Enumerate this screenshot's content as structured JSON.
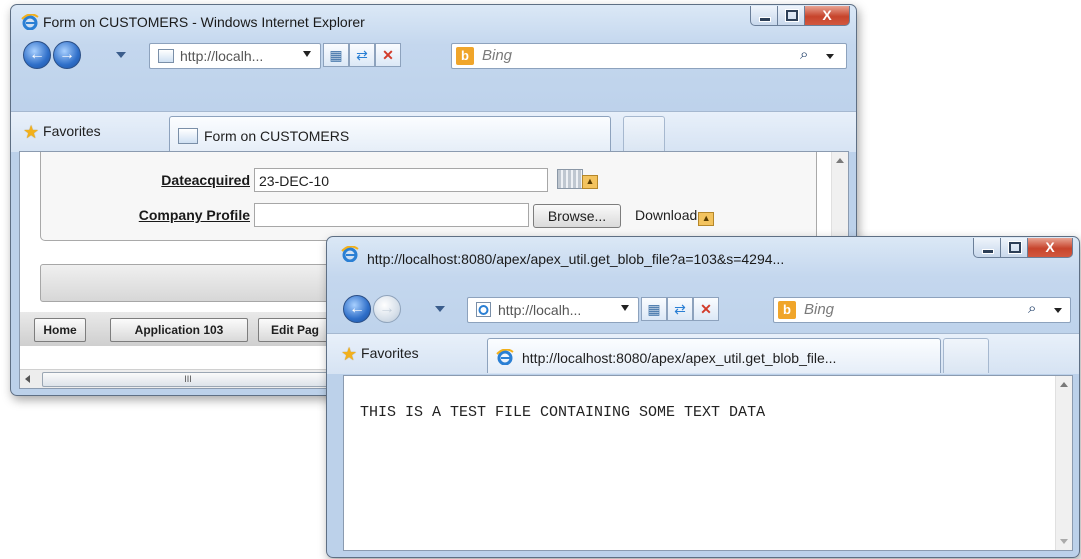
{
  "window1": {
    "title": "Form on CUSTOMERS - Windows Internet Explorer",
    "address": "http://localh...",
    "search_placeholder": "Bing",
    "favorites": "Favorites",
    "tab_title": "Form on CUSTOMERS",
    "form": {
      "dateacquired_label": "Dateacquired",
      "dateacquired_value": "23-DEC-10",
      "company_profile_label": "Company Profile",
      "browse_label": "Browse...",
      "download_label": "Download"
    },
    "devbar": [
      "Home",
      "Application 103",
      "Edit Pag"
    ],
    "hscroll_grip": "III"
  },
  "window2": {
    "title": "http://localhost:8080/apex/apex_util.get_blob_file?a=103&s=4294...",
    "address": "http://localh...",
    "search_placeholder": "Bing",
    "favorites": "Favorites",
    "tab_title": "http://localhost:8080/apex/apex_util.get_blob_file...",
    "file_content": "THIS IS A TEST FILE CONTAINING SOME TEXT DATA"
  },
  "icons": {
    "back": "left-arrow",
    "forward": "right-arrow",
    "refresh": "refresh-arrows",
    "stop": "x-mark",
    "search": "magnifier",
    "favorites": "star",
    "close": "X"
  }
}
